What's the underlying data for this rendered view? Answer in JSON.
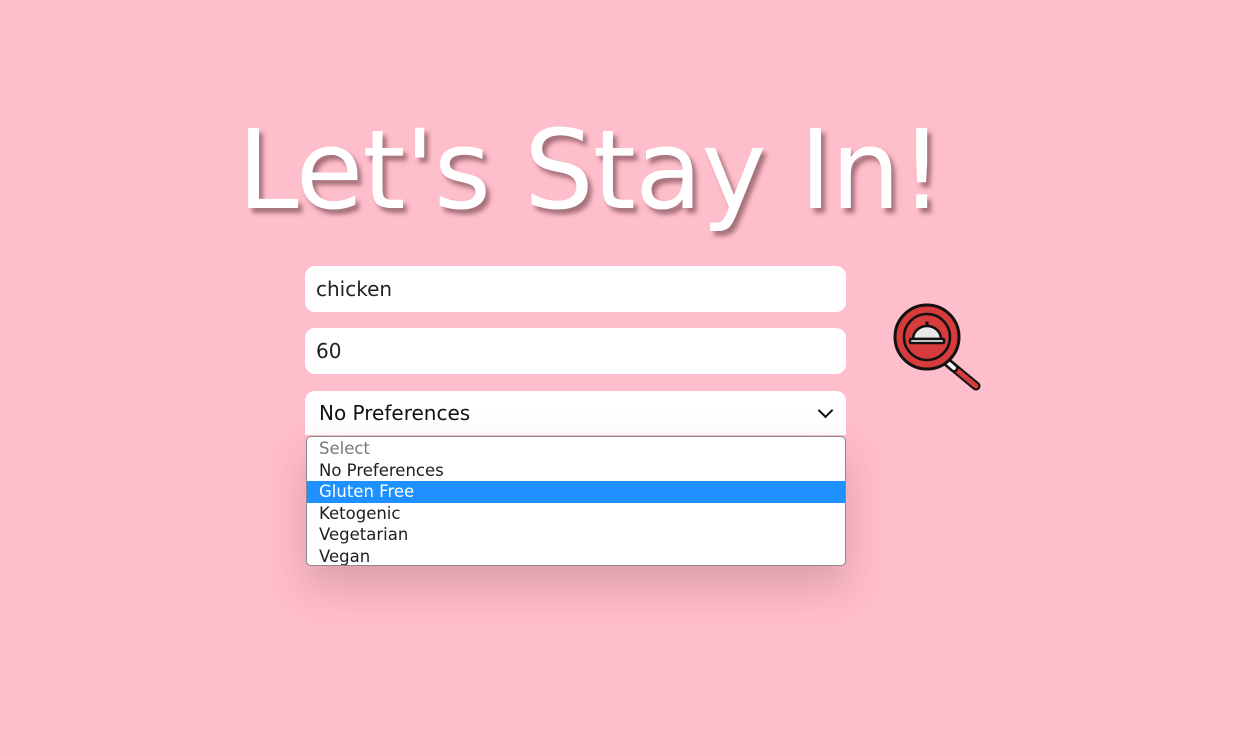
{
  "hero": {
    "title": "Let's Stay In!"
  },
  "form": {
    "ingredient_value": "chicken",
    "time_value": "60",
    "diet_selected": "No Preferences",
    "diet_options": [
      {
        "label": "Select",
        "disabled": true
      },
      {
        "label": "No Preferences"
      },
      {
        "label": "Gluten Free",
        "highlighted": true
      },
      {
        "label": "Ketogenic"
      },
      {
        "label": "Vegetarian"
      },
      {
        "label": "Vegan"
      }
    ]
  },
  "search_button": {
    "icon": "magnifier-cloche-icon"
  },
  "colors": {
    "background": "#ffbecb",
    "highlight": "#1e90ff",
    "icon_red": "#d63c3c"
  }
}
